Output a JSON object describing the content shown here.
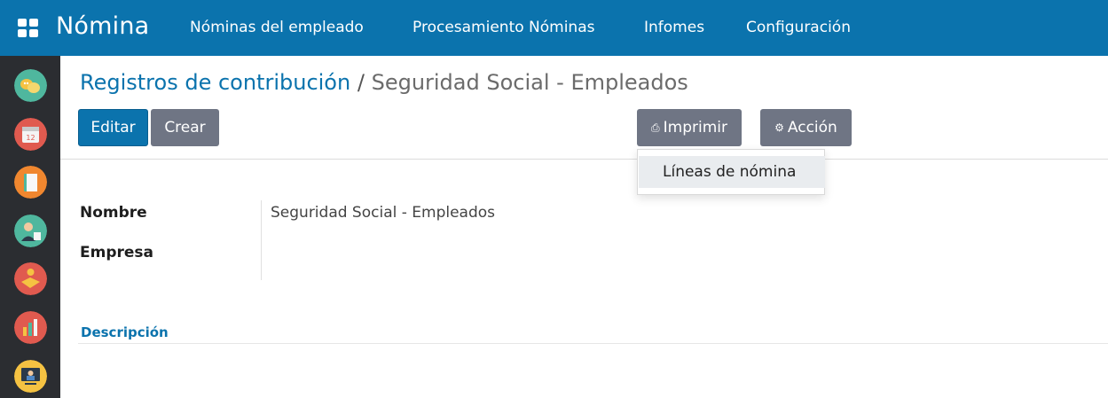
{
  "header": {
    "app_title": "Nómina",
    "menu": [
      {
        "label": "Nóminas del empleado"
      },
      {
        "label": "Procesamiento Nóminas"
      },
      {
        "label": "Infomes"
      },
      {
        "label": "Configuración"
      }
    ],
    "apps_icon": "grid-icon"
  },
  "sidebar": {
    "apps": [
      {
        "icon": "discuss-app-icon",
        "color": "#4fb79e"
      },
      {
        "icon": "calendar-app-icon",
        "color": "#e05a4f"
      },
      {
        "icon": "notes-app-icon",
        "color": "#f0872f"
      },
      {
        "icon": "employees-app-icon",
        "color": "#4fb79e"
      },
      {
        "icon": "handshake-app-icon",
        "color": "#e05a4f"
      },
      {
        "icon": "reports-app-icon",
        "color": "#e05a4f"
      },
      {
        "icon": "elearning-app-icon",
        "color": "#f5c242"
      }
    ]
  },
  "breadcrumb": {
    "parent": "Registros de contribución",
    "separator": "/",
    "current": "Seguridad Social - Empleados"
  },
  "toolbar": {
    "edit_label": "Editar",
    "create_label": "Crear",
    "print_label": "Imprimir",
    "print_icon": "printer-icon",
    "action_label": "Acción",
    "action_icon": "gear-icon"
  },
  "print_menu": {
    "items": [
      {
        "label": "Líneas de nómina"
      }
    ]
  },
  "form": {
    "name_label": "Nombre",
    "name_value": "Seguridad Social - Empleados",
    "company_label": "Empresa",
    "company_value": ""
  },
  "tabs": {
    "description_label": "Descripción"
  },
  "colors": {
    "primary": "#0b73ad",
    "secondary_button": "#6f7584",
    "sidebar_bg": "#2b2d31"
  }
}
